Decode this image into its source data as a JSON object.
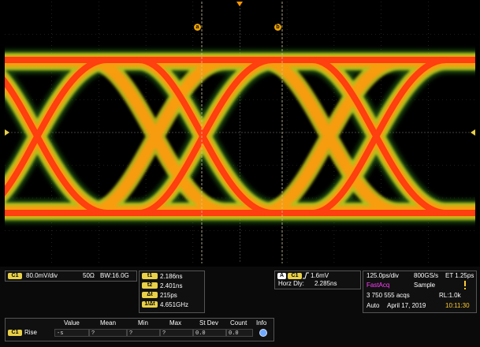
{
  "vertical": {
    "channel_badge": "C1",
    "volts_per_div": "80.0mV/div",
    "impedance": "50Ω",
    "bandwidth_label": "BW:16.0G"
  },
  "cursors": [
    {
      "badge": "t1",
      "value": "2.186ns"
    },
    {
      "badge": "t2",
      "value": "2.401ns"
    },
    {
      "badge": "Δt",
      "value": "215ps"
    },
    {
      "badge": "1/Δt",
      "value": "4.651GHz"
    }
  ],
  "trigger": {
    "badge": "A",
    "channel_badge": "C1",
    "slope_icon": "rising-edge-icon",
    "level": "1.6mV",
    "horz_delay_label": "Horz Dly:",
    "horz_delay_value": "2.285ns"
  },
  "acquisition": {
    "time_per_div": "125.0ps/div",
    "sample_rate": "800GS/s",
    "et": "ET  1.25ps",
    "mode": "FastAcq",
    "sample": "Sample",
    "acqs": "3 750 555 acqs",
    "record_length": "RL:1.0k",
    "trigger_mode": "Auto",
    "date": "April 17, 2019",
    "time": "10:11:30"
  },
  "measurements": {
    "headers": [
      "Value",
      "Mean",
      "Min",
      "Max",
      "St Dev",
      "Count",
      "Info"
    ],
    "rows": [
      {
        "channel_badge": "C1",
        "name": "Rise",
        "value": "-s",
        "mean": "?",
        "min": "?",
        "max": "?",
        "stdev": "0.0",
        "count": "0.0"
      }
    ]
  },
  "markers": {
    "cursor_a": "a",
    "cursor_b": "b"
  },
  "colors": {
    "channel": "#e8d048",
    "fastacq": "#ff40ff",
    "time": "#ffcc33"
  }
}
